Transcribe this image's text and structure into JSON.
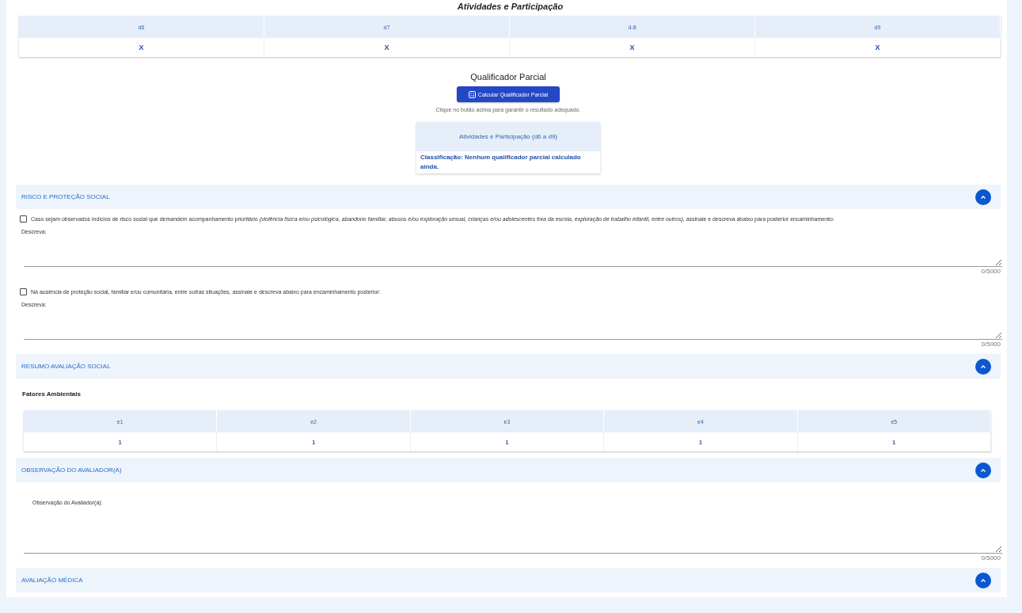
{
  "top_title": "Atividades e Participação",
  "activity_table": {
    "columns": [
      "d6",
      "d7",
      "d-8",
      "d9"
    ],
    "row": [
      "X",
      "X",
      "X",
      "X"
    ]
  },
  "partial": {
    "title": "Qualificador Parcial",
    "button": "Calcular Qualificador Parcial",
    "hint": "Clique no botão acima para garantir o resultado adequado.",
    "card_title": "Atividades e Participação (d6 a d9)",
    "card_text": "Classificação: Nenhum qualificador parcial calculado ainda."
  },
  "sections": [
    {
      "kind": "risk",
      "title": "RISCO E PROTEÇÃO SOCIAL",
      "expanded": true,
      "items": [
        {
          "label": "Caso sejam observados indícios de risco social que demandem acompanhamento prioritário *(violência física e/ou psicológica, abandono familiar, abusos e/ou exploração sexual, crianças e/ou adolescentes fora da escola, exploração de trabalho infantil, entre outros)*, assinale e descreva abaixo para posterior encaminhamento:",
          "checked": false,
          "field_label": "Descreva:",
          "counter": "0/5000"
        },
        {
          "label": "Na ausência de proteção social, familiar e/ou comunitária, entre outras situações, assinale e descreva abaixo para encaminhamento posterior:",
          "checked": false,
          "field_label": "Descreva:",
          "counter": "0/5000"
        }
      ]
    },
    {
      "kind": "summary",
      "title": "RESUMO AVALIAÇÃO SOCIAL",
      "expanded": true,
      "subtitle": "Fatores Ambientais",
      "columns": [
        "e1",
        "e2",
        "e3",
        "e4",
        "e5"
      ],
      "row": [
        "1",
        "1",
        "1",
        "1",
        "1"
      ]
    },
    {
      "kind": "observation",
      "title": "OBSERVAÇÃO DO AVALIADOR(A)",
      "expanded": true,
      "field_label": "Observação do Avaliador(a):",
      "counter": "0/5000"
    },
    {
      "kind": "header",
      "title": "AVALIAÇÃO MÉDICA",
      "expanded": true
    }
  ]
}
